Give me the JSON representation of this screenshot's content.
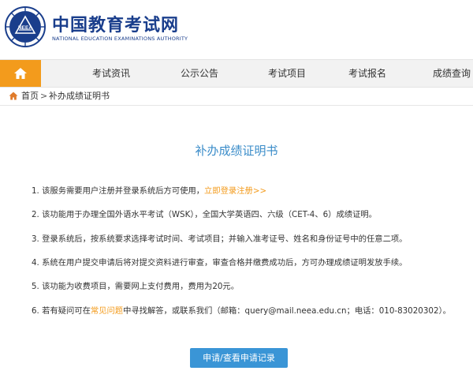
{
  "header": {
    "logo_emblem_text": "NEEA",
    "title": "中国教育考试网",
    "subtitle": "NATIONAL EDUCATION EXAMINATIONS AUTHORITY"
  },
  "nav": {
    "items": [
      "考试资讯",
      "公示公告",
      "考试项目",
      "考试报名",
      "成绩查询"
    ]
  },
  "breadcrumb": {
    "home": "首页",
    "separator": ">",
    "current": "补办成绩证明书"
  },
  "page": {
    "title": "补办成绩证明书"
  },
  "notes": {
    "n1_text": "1. 该服务需要用户注册并登录系统后方可使用，",
    "n1_link": "立即登录注册>>",
    "n2": "2. 该功能用于办理全国外语水平考试（WSK），全国大学英语四、六级（CET-4、6）成绩证明。",
    "n3": "3. 登录系统后，按系统要求选择考试时间、考试项目；并输入准考证号、姓名和身份证号中的任意二项。",
    "n4": "4. 系统在用户提交申请后将对提交资料进行审查，审查合格并缴费成功后，方可办理成绩证明发放手续。",
    "n5": "5. 该功能为收费项目，需要网上支付费用，费用为20元。",
    "n6_pre": "6. 若有疑问可在",
    "n6_link": "常见问题",
    "n6_mid": "中寻找解答，或联系我们（邮箱：query@mail.neea.edu.cn；电话：010-83020302）。"
  },
  "actions": {
    "apply_button": "申请/查看申请记录"
  },
  "colors": {
    "brand_blue": "#1a3e8c",
    "accent_orange": "#f39b1c",
    "title_blue": "#3a8cc9",
    "button_blue": "#3a95d6"
  },
  "icons": [
    "neea-emblem-icon",
    "home-icon",
    "breadcrumb-home-icon"
  ]
}
